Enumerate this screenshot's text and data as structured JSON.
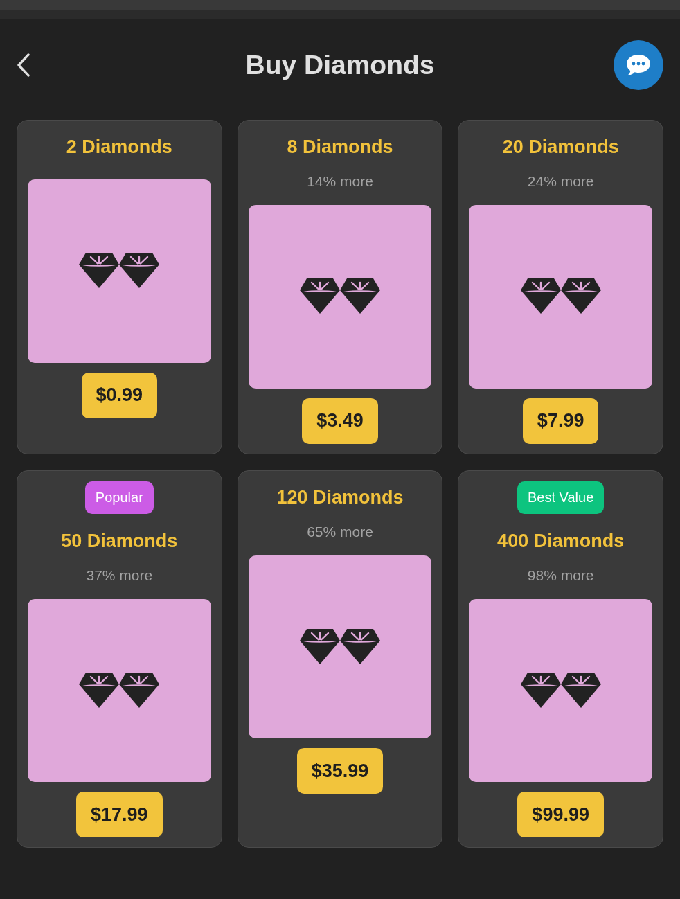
{
  "header": {
    "title": "Buy Diamonds"
  },
  "packs": [
    {
      "title": "2 Diamonds",
      "price": "$0.99"
    },
    {
      "title": "8 Diamonds",
      "bonus": "14% more",
      "price": "$3.49"
    },
    {
      "title": "20 Diamonds",
      "bonus": "24% more",
      "price": "$7.99"
    },
    {
      "badge": {
        "label": "Popular",
        "color": "#cc5ce6"
      },
      "title": "50 Diamonds",
      "bonus": "37% more",
      "price": "$17.99"
    },
    {
      "title": "120 Diamonds",
      "bonus": "65% more",
      "price": "$35.99"
    },
    {
      "badge": {
        "label": "Best Value",
        "color": "#0dc47f"
      },
      "title": "400 Diamonds",
      "bonus": "98% more",
      "price": "$99.99"
    }
  ]
}
